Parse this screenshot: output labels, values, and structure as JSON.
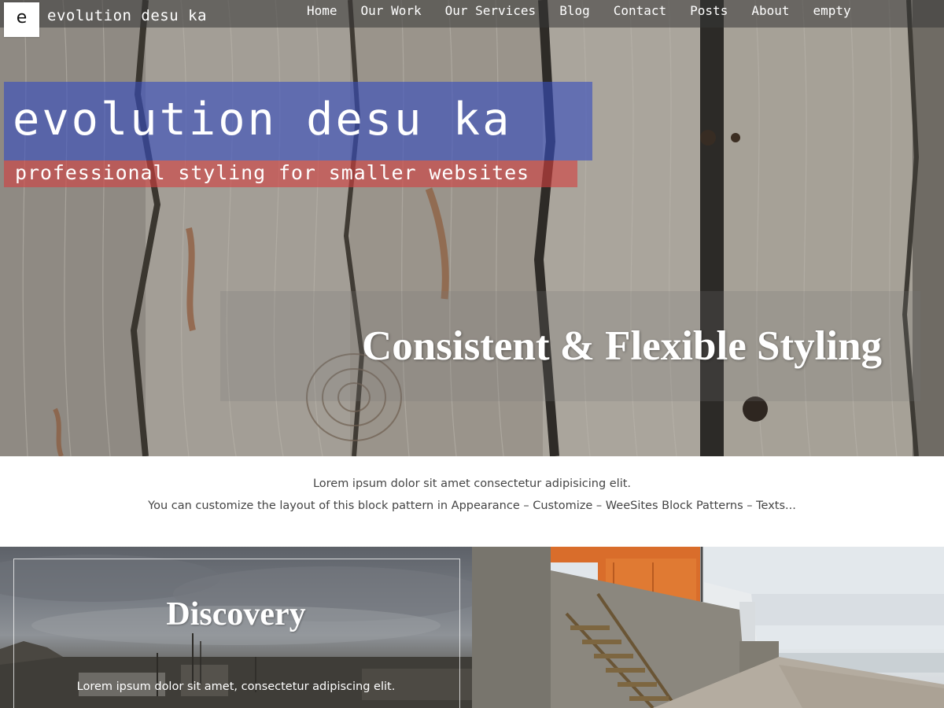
{
  "site": {
    "logo_letter": "e",
    "name": "evolution desu ka"
  },
  "nav": {
    "items": [
      {
        "label": "Home"
      },
      {
        "label": "Our Work"
      },
      {
        "label": "Our Services"
      },
      {
        "label": "Blog"
      },
      {
        "label": "Contact"
      },
      {
        "label": "Posts"
      },
      {
        "label": "About"
      },
      {
        "label": "empty"
      }
    ]
  },
  "hero": {
    "title": "evolution desu ka",
    "tagline": "professional styling for smaller websites",
    "headline": "Consistent & Flexible Styling"
  },
  "intro": {
    "line1": "Lorem ipsum dolor sit amet consectetur adipisicing elit.",
    "line2": "You can customize the layout of this block pattern in Appearance – Customize – WeeSites Block Patterns – Texts..."
  },
  "tiles": [
    {
      "title": "Discovery",
      "text": "Lorem ipsum dolor sit amet, consectetur adipiscing elit."
    }
  ],
  "colors": {
    "title_band": "#374ebe",
    "tagline_band": "#d24141",
    "nav_bar": "#373737"
  }
}
